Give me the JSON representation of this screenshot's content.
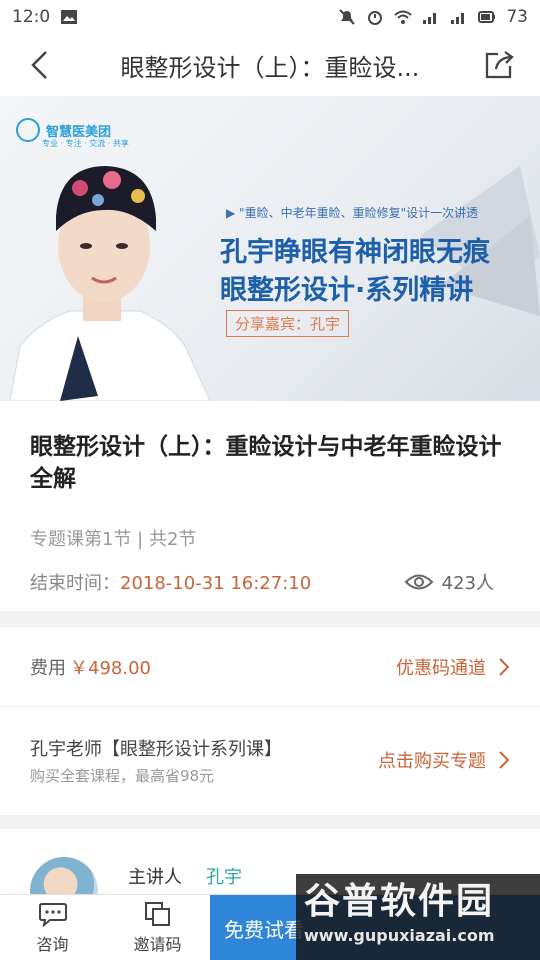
{
  "status_bar": {
    "time": "12:0",
    "battery": "73",
    "icons": [
      "image-icon",
      "mute-icon",
      "alarm-icon",
      "wifi-icon",
      "signal-icon",
      "signal-icon",
      "battery-icon"
    ]
  },
  "nav": {
    "title": "眼整形设计（上）：重睑设...",
    "back_icon": "back-arrow-icon",
    "share_icon": "share-icon"
  },
  "banner": {
    "logo_text": "智慧医美团",
    "logo_sub": "专业 · 专注 · 交流 · 共享",
    "tag": "▶ \"重睑、中老年重睑、重睑修复\"设计一次讲透",
    "headline_1": "孔宇睁眼有神闭眼无痕",
    "headline_2": "眼整形设计·系列精讲",
    "guest": "分享嘉宾：孔宇"
  },
  "course": {
    "title": "眼整形设计（上）：重睑设计与中老年重睑设计全解",
    "subtitle": "专题课第1节 | 共2节",
    "end_label": "结束时间：",
    "end_time": "2018-10-31 16:27:10",
    "views": "423人"
  },
  "pricing": {
    "fee_label": "费用",
    "fee_value": "￥498.00",
    "coupon_label": "优惠码通道",
    "topic_name": "孔宇老师【眼整形设计系列课】",
    "topic_note": "购买全套课程，最高省98元",
    "buy_label": "点击购买专题"
  },
  "speaker": {
    "label": "主讲人",
    "name": "孔宇"
  },
  "bottom_bar": {
    "consult": "咨询",
    "invite": "邀请码",
    "trial": "免费试看"
  },
  "watermark": {
    "main": "谷普软件园",
    "url": "www.gupuxiazai.com"
  },
  "colors": {
    "accent": "#c9643a",
    "primary_button": "#2f86d8",
    "speaker_name": "#2aa8a0"
  }
}
